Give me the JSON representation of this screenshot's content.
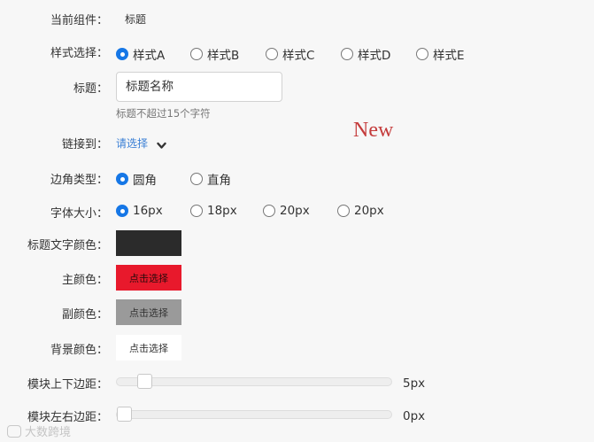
{
  "current_component": {
    "label": "当前组件：",
    "value": "标题"
  },
  "style_select": {
    "label": "样式选择：",
    "options": [
      "样式A",
      "样式B",
      "样式C",
      "样式D",
      "样式E"
    ],
    "selected": "样式A"
  },
  "title_field": {
    "label": "标题：",
    "value": "标题名称",
    "hint": "标题不超过15个字符"
  },
  "link_to": {
    "label": "链接到：",
    "link_text": "请选择"
  },
  "corner_type": {
    "label": "边角类型：",
    "options": [
      "圆角",
      "直角"
    ],
    "selected": "圆角"
  },
  "font_size": {
    "label": "字体大小：",
    "options": [
      "16px",
      "18px",
      "20px",
      "20px"
    ],
    "selected": "16px"
  },
  "title_text_color": {
    "label": "标题文字颜色：",
    "color": "#2b2b2b"
  },
  "primary_color": {
    "label": "主颜色：",
    "button_text": "点击选择",
    "color": "#e8192c"
  },
  "secondary_color": {
    "label": "副颜色：",
    "button_text": "点击选择",
    "color": "#9a9a9a"
  },
  "background_color": {
    "label": "背景颜色：",
    "button_text": "点击选择",
    "color": "#ffffff"
  },
  "vertical_margin": {
    "label": "模块上下边距：",
    "value": 5,
    "unit": "px",
    "display": "5px"
  },
  "horizontal_margin": {
    "label": "模块左右边距：",
    "value": 0,
    "unit": "px",
    "display": "0px"
  },
  "annotation": {
    "text": "New",
    "color": "#c43b3b"
  },
  "watermark": {
    "text": "大数跨境"
  }
}
